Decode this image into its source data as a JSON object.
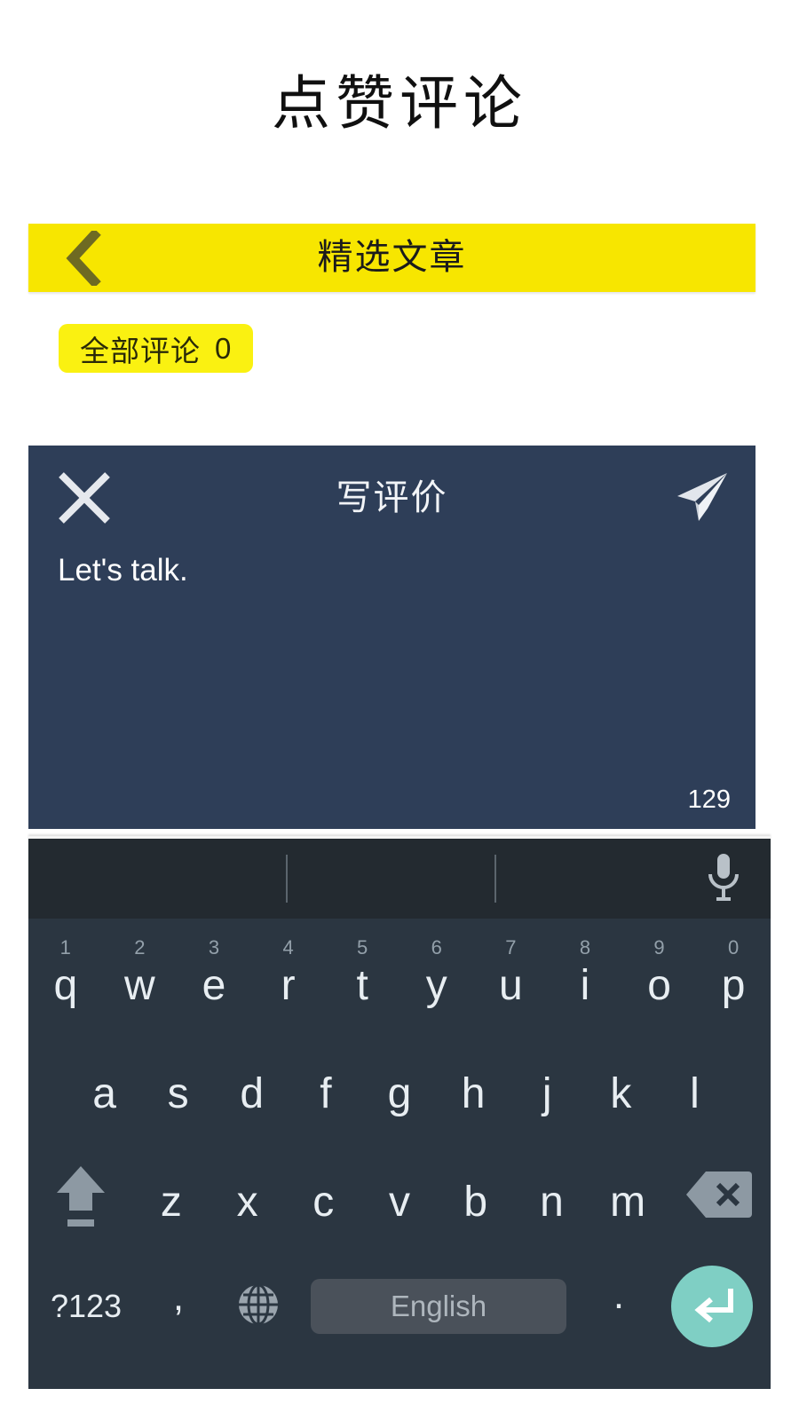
{
  "page": {
    "title": "点赞评论"
  },
  "nav": {
    "back_icon": "chevron-left-icon",
    "title": "精选文章",
    "bar_color": "#f7e600",
    "back_icon_color": "#6e6a22"
  },
  "comment_count": {
    "label": "全部评论",
    "value": "0",
    "badge_color": "#faf111"
  },
  "composer": {
    "close_icon": "close-icon",
    "title": "写评价",
    "send_icon": "send-paper-plane-icon",
    "text": "Let's talk.",
    "counter": "129",
    "panel_color": "#2e3e58"
  },
  "keyboard": {
    "mic_icon": "microphone-icon",
    "row1": [
      {
        "letter": "q",
        "number": "1"
      },
      {
        "letter": "w",
        "number": "2"
      },
      {
        "letter": "e",
        "number": "3"
      },
      {
        "letter": "r",
        "number": "4"
      },
      {
        "letter": "t",
        "number": "5"
      },
      {
        "letter": "y",
        "number": "6"
      },
      {
        "letter": "u",
        "number": "7"
      },
      {
        "letter": "i",
        "number": "8"
      },
      {
        "letter": "o",
        "number": "9"
      },
      {
        "letter": "p",
        "number": "0"
      }
    ],
    "row2": [
      {
        "letter": "a"
      },
      {
        "letter": "s"
      },
      {
        "letter": "d"
      },
      {
        "letter": "f"
      },
      {
        "letter": "g"
      },
      {
        "letter": "h"
      },
      {
        "letter": "j"
      },
      {
        "letter": "k"
      },
      {
        "letter": "l"
      }
    ],
    "row3": [
      {
        "letter": "z"
      },
      {
        "letter": "x"
      },
      {
        "letter": "c"
      },
      {
        "letter": "v"
      },
      {
        "letter": "b"
      },
      {
        "letter": "n"
      },
      {
        "letter": "m"
      }
    ],
    "shift_icon": "shift-arrow-icon",
    "backspace_icon": "backspace-icon",
    "symbols_label": "?123",
    "comma_label": ",",
    "globe_icon": "globe-language-icon",
    "space_label": "English",
    "period_label": ".",
    "enter_icon": "enter-return-icon",
    "enter_color": "#7fcfc4",
    "background_color": "#2b3641",
    "suggestion_strip_color": "#232a30"
  }
}
